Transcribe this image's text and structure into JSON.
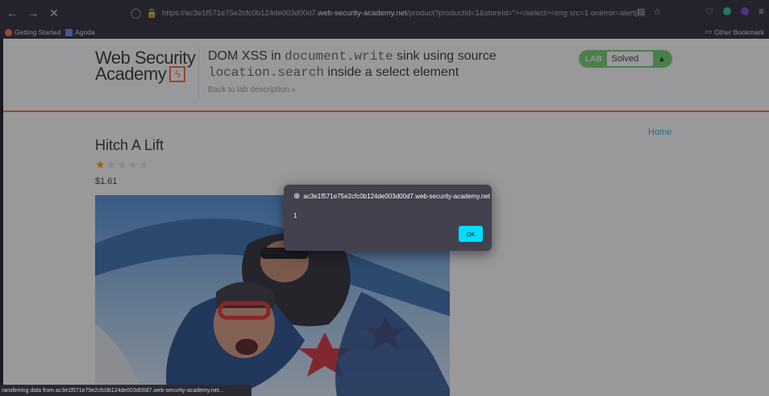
{
  "browser": {
    "url_prefix": "https://ac3e1f571e75e2cfc0b124de003d00d7.",
    "url_domain": "web-security-academy.net",
    "url_suffix": "/product?productId=1&storeId=\"></select><img src=1 onerror=alert(",
    "bookmarks": [
      {
        "label": "Getting Started",
        "icon": "firefox-icon"
      },
      {
        "label": "Agoda",
        "icon": "agoda-icon"
      }
    ],
    "other_bookmarks": "Other Bookmark",
    "status": "ransferring data from ac3e1f571e75e2cfc0b124de003d00d7.web-security-academy.net..."
  },
  "header": {
    "logo_line1": "Web Security",
    "logo_line2": "Academy",
    "lab_title_a": "DOM XSS in ",
    "lab_title_code1": "document.write",
    "lab_title_b": " sink using source",
    "lab_title_code2": "location.search",
    "lab_title_c": " inside a select element",
    "back_link": "Back to lab description  »",
    "badge_lab": "LAB",
    "badge_status": "Solved"
  },
  "nav": {
    "home": "Home"
  },
  "product": {
    "title": "Hitch A Lift",
    "rating": 1,
    "max_rating": 5,
    "price": "$1.61"
  },
  "dialog": {
    "origin": "ac3e1f571e75e2cfc0b124de003d00d7.web-security-academy.net",
    "message": "1",
    "ok_label": "OK"
  },
  "colors": {
    "accent": "#ff6633",
    "solved": "#70d16d",
    "link": "#29ace5",
    "ok": "#00ddff"
  }
}
